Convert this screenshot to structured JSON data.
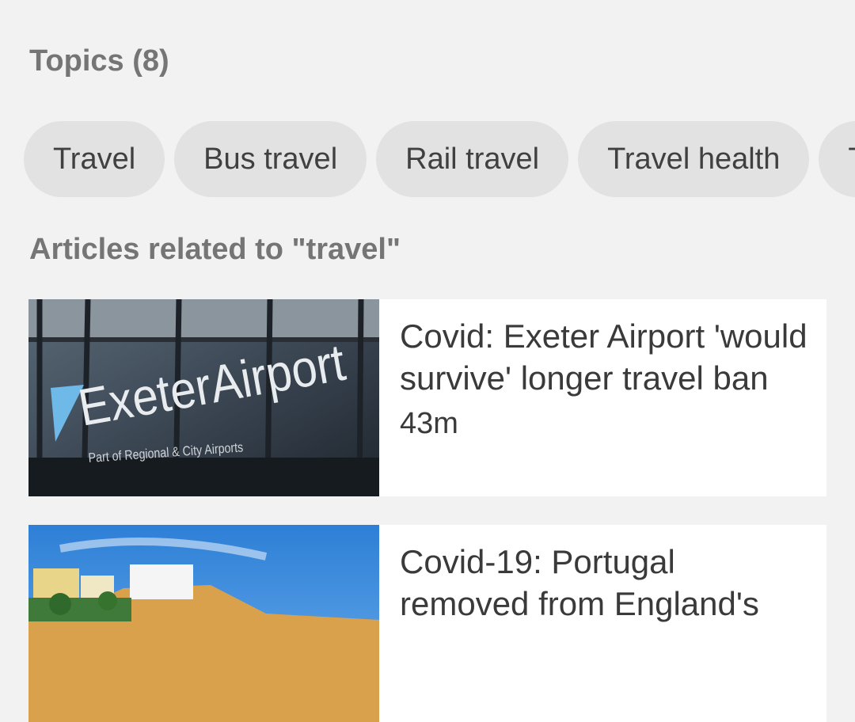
{
  "topics": {
    "title": "Topics (8)",
    "chips": [
      "Travel",
      "Bus travel",
      "Rail travel",
      "Travel health",
      "T"
    ]
  },
  "articles": {
    "title": "Articles related to \"travel\"",
    "items": [
      {
        "headline": "Covid: Exeter Airport 'would survive' longer travel ban",
        "time": "43m",
        "image": {
          "logo_text": "ExeterAirport",
          "sub_text": "Part of Regional & City Airports"
        }
      },
      {
        "headline": "Covid-19: Portugal removed from England's",
        "time": ""
      }
    ]
  }
}
